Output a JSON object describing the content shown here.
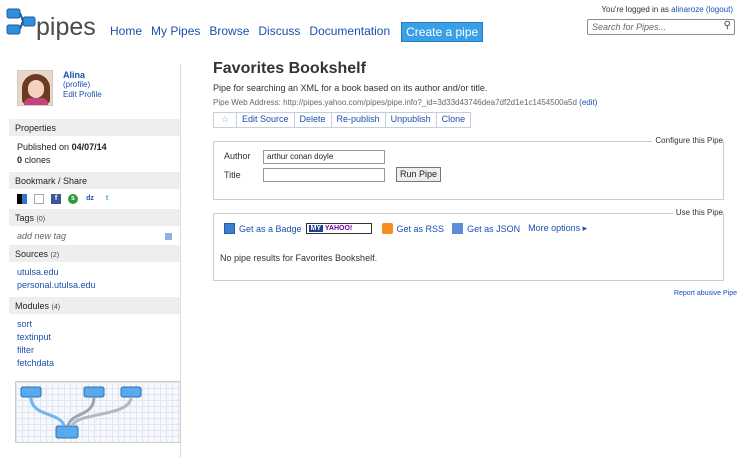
{
  "header": {
    "logo_text": "pipes",
    "nav": [
      "Home",
      "My Pipes",
      "Browse",
      "Discuss",
      "Documentation"
    ],
    "create_label": "Create a pipe",
    "logged_in_prefix": "You're logged in as",
    "username": "alinaroze",
    "logout": "(logout)",
    "search_placeholder": "Search for Pipes..."
  },
  "sidebar": {
    "user": {
      "name": "Alina",
      "profile": "(profile)",
      "edit": "Edit Profile"
    },
    "properties": {
      "heading": "Properties",
      "published_label": "Published on",
      "published_date": "04/07/14",
      "clones_count": "0",
      "clones_label": "clones"
    },
    "bookmark": {
      "heading": "Bookmark / Share"
    },
    "tags": {
      "heading": "Tags",
      "count": "(0)",
      "add": "add new tag"
    },
    "sources": {
      "heading": "Sources",
      "count": "(2)",
      "items": [
        "utulsa.edu",
        "personal.utulsa.edu"
      ]
    },
    "modules": {
      "heading": "Modules",
      "count": "(4)",
      "items": [
        "sort",
        "textinput",
        "filter",
        "fetchdata"
      ]
    }
  },
  "main": {
    "title": "Favorites Bookshelf",
    "description": "Pipe for searching an XML for a book based on its author and/or title.",
    "web_address_label": "Pipe Web Address:",
    "web_address": "http://pipes.yahoo.com/pipes/pipe.info?_id=3d33d43746dea7df2d1e1c1454500a5d",
    "edit": "(edit)",
    "toolbar": [
      "Edit Source",
      "Delete",
      "Re-publish",
      "Unpublish",
      "Clone"
    ],
    "configure": {
      "legend": "Configure this Pipe",
      "author_label": "Author",
      "author_value": "arthur conan doyle",
      "title_label": "Title",
      "title_value": "",
      "run": "Run Pipe"
    },
    "use": {
      "legend": "Use this Pipe",
      "badge": "Get as a Badge",
      "my_yahoo_my": "MY",
      "my_yahoo_rest": "YAHOO!",
      "rss": "Get as RSS",
      "json": "Get as JSON",
      "more": "More options",
      "no_results": "No pipe results for Favorites Bookshelf."
    },
    "report": "Report abusive Pipe"
  },
  "colors": {
    "link": "#1a4fb0",
    "create_button": "#3aa0e4",
    "sidebar_head": "#eeeeee"
  }
}
